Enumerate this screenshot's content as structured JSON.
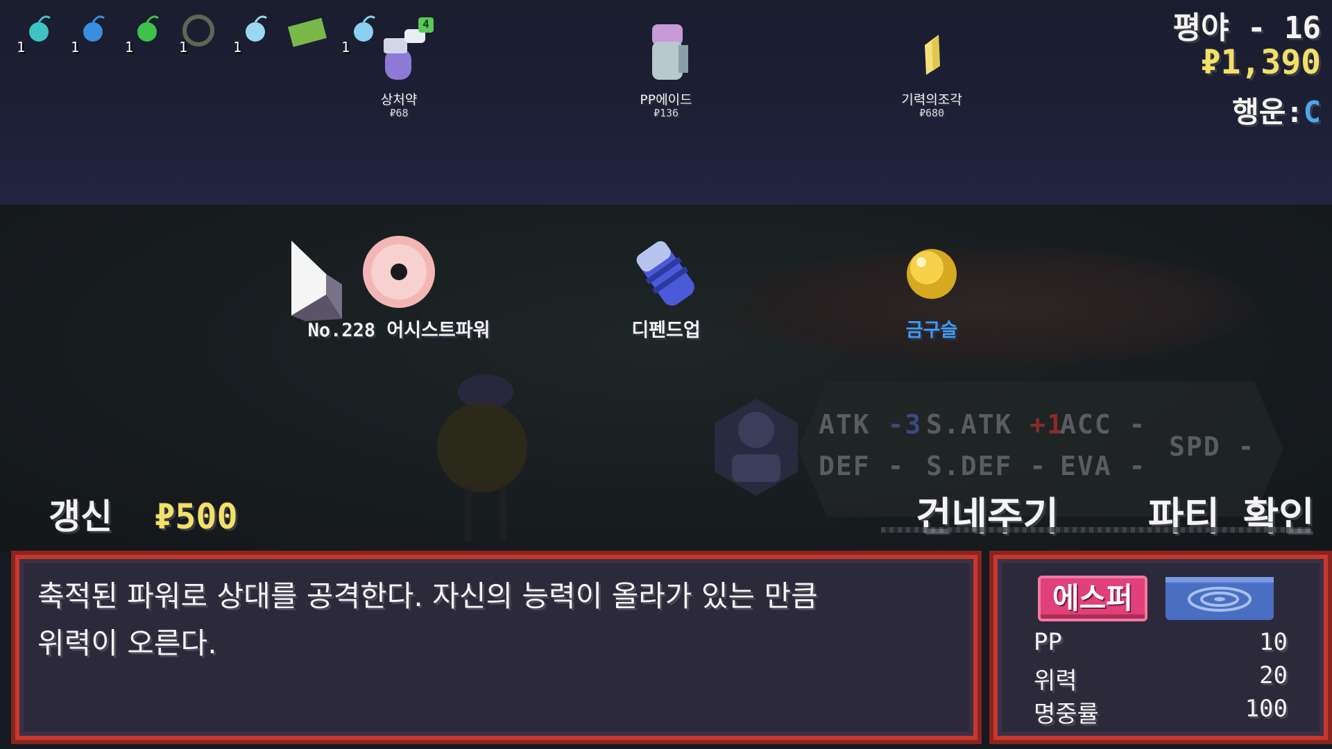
{
  "header": {
    "location": "평야 - 16",
    "money": "₽1,390",
    "luck_label": "행운:",
    "luck_value": "C"
  },
  "held_items": [
    {
      "icon": "teal-berry-icon",
      "count": "1"
    },
    {
      "icon": "blue-orb-icon",
      "count": "1"
    },
    {
      "icon": "green-berry-icon",
      "count": "1"
    },
    {
      "icon": "dark-claw-icon",
      "count": "1"
    },
    {
      "icon": "light-blue-orb-icon",
      "count": "1"
    },
    {
      "icon": "map-scroll-icon",
      "count": ""
    },
    {
      "icon": "sparkle-icon",
      "count": "1"
    }
  ],
  "shop_items": [
    {
      "name": "상처약",
      "price": "₽68",
      "icon": "potion-spray-icon",
      "badge": "4"
    },
    {
      "name": "PP에이드",
      "price": "₽136",
      "icon": "pp-ade-icon"
    },
    {
      "name": "기력의조각",
      "price": "₽680",
      "icon": "revive-shard-icon"
    }
  ],
  "rewards": [
    {
      "name": "No.228 어시스트파워",
      "icon": "tm-disc-icon"
    },
    {
      "name": "디펜드업",
      "icon": "x-defense-icon"
    },
    {
      "name": "금구슬",
      "icon": "gold-orb-icon"
    }
  ],
  "stats": {
    "atk": {
      "label": "ATK",
      "value": "-3"
    },
    "satk": {
      "label": "S.ATK",
      "value": "+1"
    },
    "acc": {
      "label": "ACC",
      "value": "-"
    },
    "spd": {
      "label": "SPD",
      "value": "-"
    },
    "def": {
      "label": "DEF",
      "value": "-"
    },
    "sdef": {
      "label": "S.DEF",
      "value": "-"
    },
    "eva": {
      "label": "EVA",
      "value": "-"
    }
  },
  "actions": {
    "reroll_label": "갱신",
    "reroll_cost": "₽500",
    "transfer_label": "건네주기",
    "party_label": "파티 확인"
  },
  "description": {
    "line1": "축적된 파워로 상대를 공격한다. 자신의 능력이 올라가 있는 만큼",
    "line2": "위력이 오른다."
  },
  "move": {
    "type": "에스퍼",
    "category_icon": "special-category-icon",
    "pp_label": "PP",
    "pp_value": "10",
    "power_label": "위력",
    "power_value": "20",
    "accuracy_label": "명중률",
    "accuracy_value": "100"
  },
  "colors": {
    "money": "#f2e06a",
    "luck_c": "#4aa8f0",
    "gold_orb_label": "#3c9cf5",
    "stat_down": "#3a4a80",
    "stat_up": "#8a2a2a",
    "type_psychic": "#e0417a",
    "panel_border": "#c8382c"
  }
}
